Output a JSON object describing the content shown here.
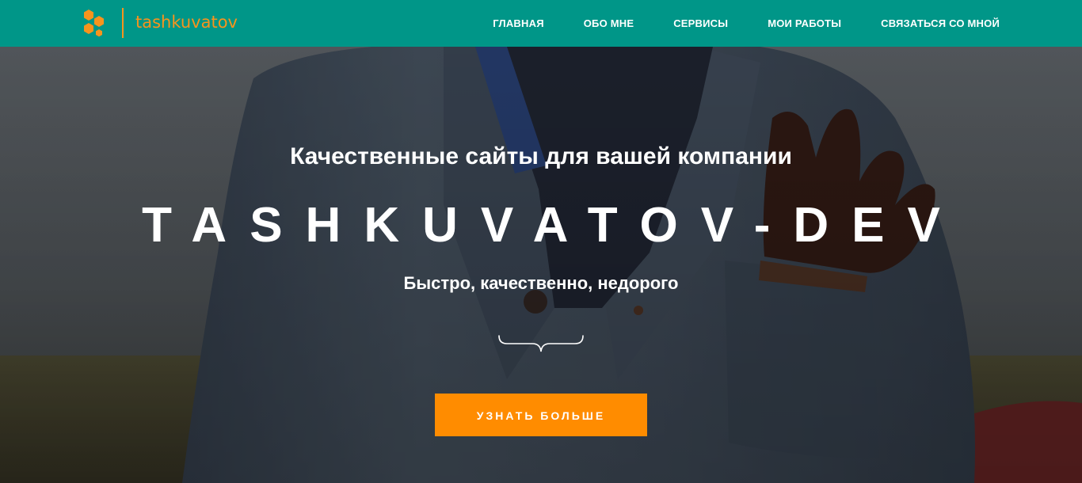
{
  "header": {
    "brand": "tashkuvatov",
    "nav": [
      {
        "label": "ГЛАВНАЯ"
      },
      {
        "label": "ОБО МНЕ"
      },
      {
        "label": "СЕРВИСЫ"
      },
      {
        "label": "МОИ РАБОТЫ"
      },
      {
        "label": "СВЯЗАТЬСЯ СО МНОЙ"
      }
    ]
  },
  "hero": {
    "subtitle": "Качественные сайты для вашей компании",
    "title": "TASHKUVATOV-DEV",
    "tagline": "Быстро, качественно, недорого",
    "cta_label": "УЗНАТЬ БОЛЬШЕ"
  },
  "colors": {
    "header_bg": "#009688",
    "accent": "#f7941d",
    "cta_bg": "#ff8c00",
    "text_light": "#ffffff"
  },
  "icons": {
    "logo": "hexagon-cluster-icon",
    "divider": "curly-brace-icon"
  }
}
